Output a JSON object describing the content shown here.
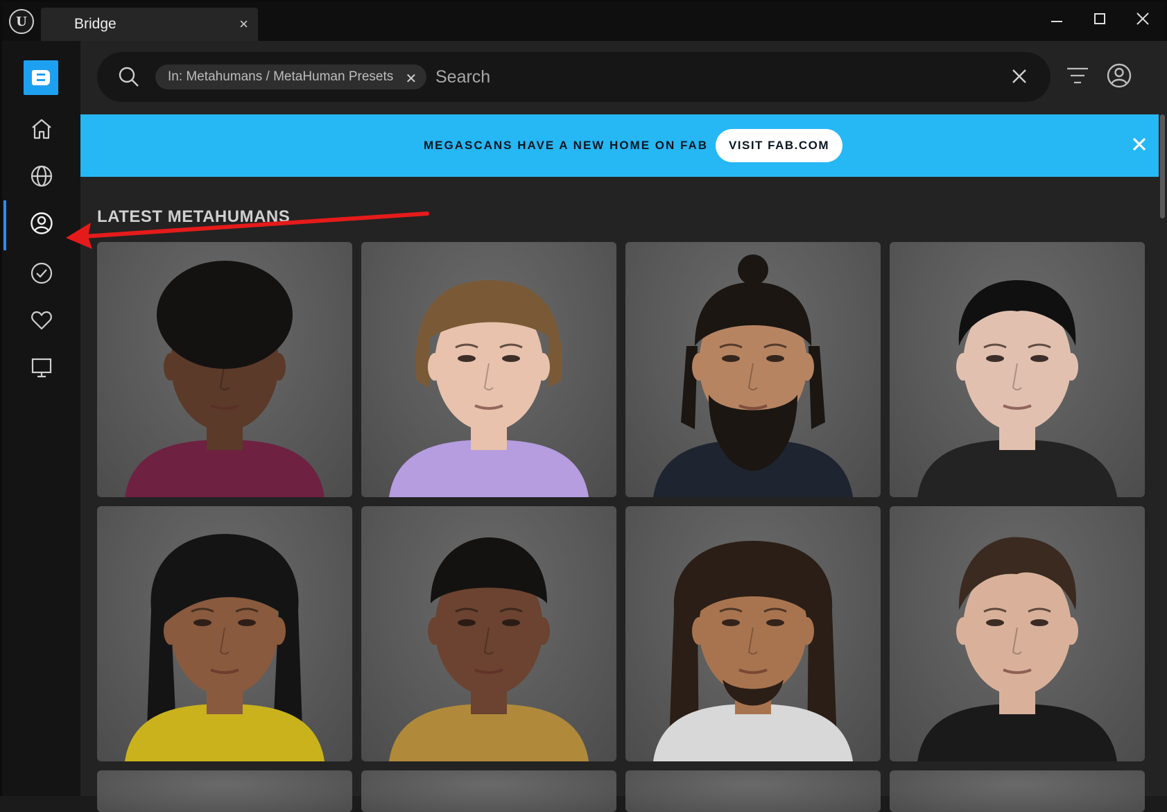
{
  "window": {
    "tab_title": "Bridge",
    "tab_close": "×",
    "close_glyph": "✕"
  },
  "sidebar": {
    "brand_icon": "bridge-logo",
    "items": [
      {
        "name": "home",
        "icon": "home-icon"
      },
      {
        "name": "globe",
        "icon": "globe-icon"
      },
      {
        "name": "metahumans",
        "icon": "user-circle-icon",
        "active": true
      },
      {
        "name": "downloaded",
        "icon": "check-circle-icon"
      },
      {
        "name": "favorites",
        "icon": "heart-icon"
      },
      {
        "name": "local",
        "icon": "monitor-icon"
      }
    ],
    "active_color": "#2b8cff"
  },
  "search": {
    "chip_label": "In: Metahumans / MetaHuman Presets",
    "chip_close": "✕",
    "placeholder": "Search"
  },
  "banner": {
    "text": "MEGASCANS HAVE A NEW HOME ON FAB",
    "button_label": "VISIT FAB.COM",
    "background": "#26b7f5"
  },
  "section": {
    "title": "LATEST METAHUMANS"
  },
  "cards": [
    {
      "skin": "#5b3a2a",
      "hair": "#141210",
      "top": "#6e2140",
      "style": "curly"
    },
    {
      "skin": "#e8c2ad",
      "hair": "#7a5a36",
      "top": "#b59de0",
      "style": "bob"
    },
    {
      "skin": "#b78462",
      "hair": "#1b1612",
      "top": "#1e2430",
      "style": "bun-beard"
    },
    {
      "skin": "#e2c0b0",
      "hair": "#101010",
      "top": "#232323",
      "style": "slick"
    },
    {
      "skin": "#8a5a3e",
      "hair": "#141414",
      "top": "#c9b21c",
      "style": "long"
    },
    {
      "skin": "#6b4330",
      "hair": "#141210",
      "top": "#b08a3a",
      "style": "short"
    },
    {
      "skin": "#a8744f",
      "hair": "#2a1e16",
      "top": "#d8d8d8",
      "style": "long-beard"
    },
    {
      "skin": "#d9b19a",
      "hair": "#3a2a20",
      "top": "#1a1a1a",
      "style": "swept"
    }
  ],
  "annotation": {
    "arrow_color": "#e51b1b"
  }
}
